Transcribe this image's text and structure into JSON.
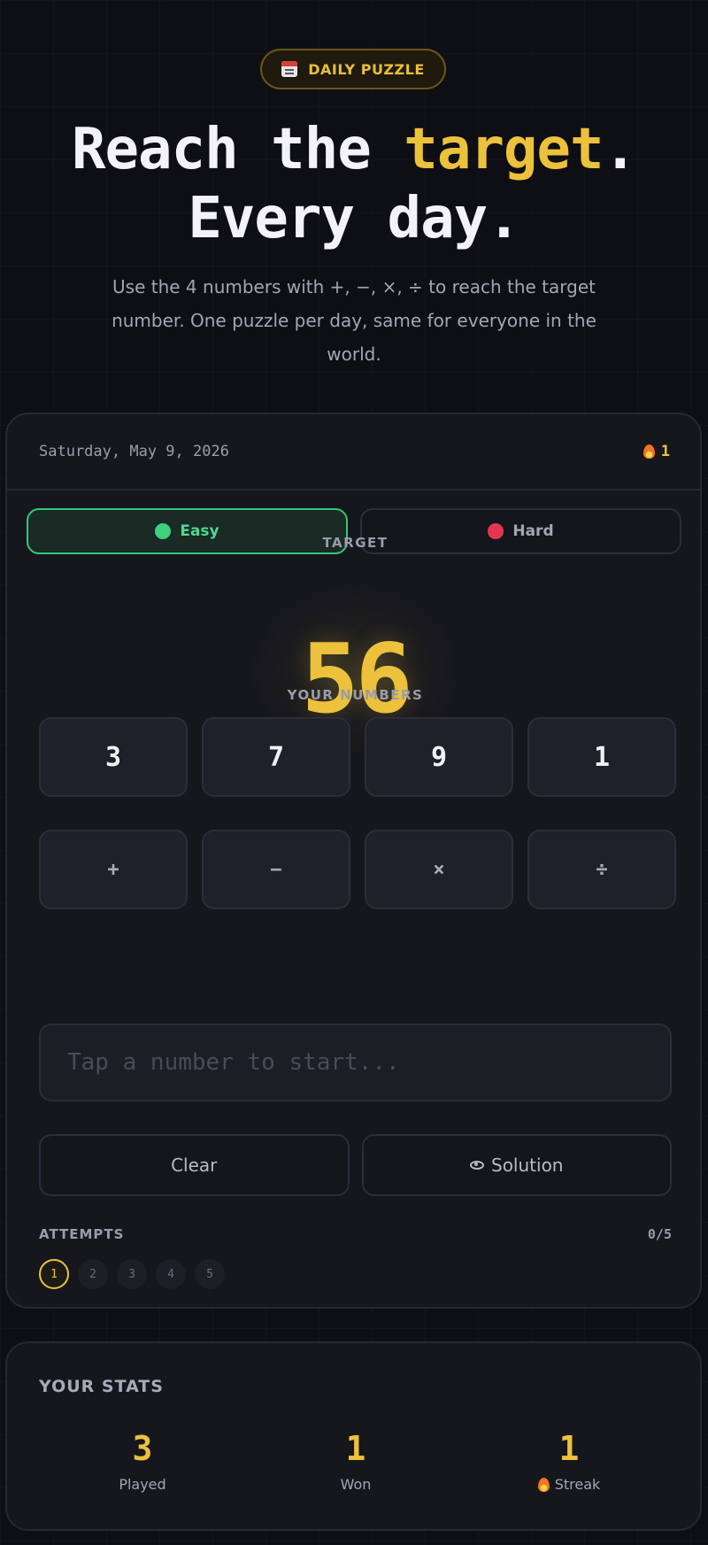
{
  "badge": {
    "label": "DAILY PUZZLE",
    "icon": "calendar-icon"
  },
  "hero": {
    "title_line1_prefix": "Reach the ",
    "title_accent": "target",
    "title_line1_suffix": ".",
    "title_line2": "Every day.",
    "subtitle": "Use the 4 numbers with +, −, ×, ÷ to reach the target number. One puzzle per day, same for everyone in the world."
  },
  "game": {
    "date": "Saturday, May 9, 2026",
    "streak": "1",
    "modes": [
      {
        "label": "Easy",
        "color": "#3ecf7f",
        "active": true
      },
      {
        "label": "Hard",
        "color": "#e5364f",
        "active": false
      }
    ],
    "target_label": "TARGET",
    "target_value": "56",
    "numbers_label": "YOUR NUMBERS",
    "numbers": [
      "3",
      "7",
      "9",
      "1"
    ],
    "operators": [
      "+",
      "−",
      "×",
      "÷"
    ],
    "expression_placeholder": "Tap a number to start...",
    "clear_label": "Clear",
    "solution_label": "Solution",
    "attempts_label": "ATTEMPTS",
    "attempts_count": "0/5",
    "attempt_slots": [
      "1",
      "2",
      "3",
      "4",
      "5"
    ]
  },
  "stats": {
    "title": "YOUR STATS",
    "items": [
      {
        "value": "3",
        "label": "Played"
      },
      {
        "value": "1",
        "label": "Won"
      },
      {
        "value": "1",
        "label": "Streak"
      }
    ]
  },
  "colors": {
    "accent": "#ecc13c",
    "easy": "#3ecf7f",
    "hard": "#e5364f",
    "background": "#0e0f14"
  }
}
